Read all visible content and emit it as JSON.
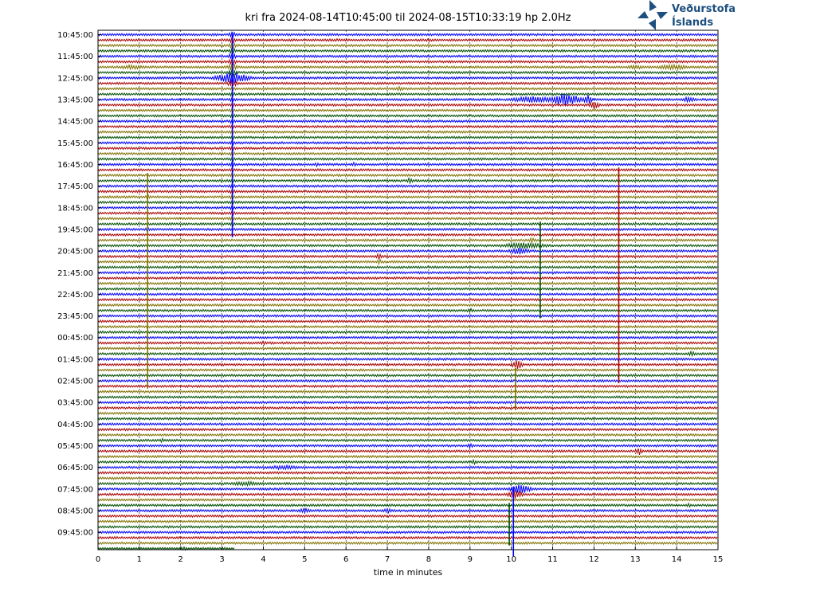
{
  "colors": {
    "trace_cycle": [
      "#0000ff",
      "#aa0000",
      "#807000",
      "#004f00"
    ],
    "logo": "#1d4f7f",
    "grid": "#000000"
  },
  "logo": {
    "icon": "vedurstofa-cross-arrows-icon",
    "line1": "Veðurstofa",
    "line2": "Íslands"
  },
  "chart_data": {
    "type": "line",
    "title": "kri fra 2024-08-14T10:45:00 til 2024-08-15T10:33:19 hp 2.0Hz",
    "xlabel": "time in minutes",
    "ylabel": "",
    "xlim": [
      0,
      15
    ],
    "x_ticks": [
      "0",
      "1",
      "2",
      "3",
      "4",
      "5",
      "6",
      "7",
      "8",
      "9",
      "10",
      "11",
      "12",
      "13",
      "14",
      "15"
    ],
    "y_tick_labels": [
      "10:45:00",
      "11:45:00",
      "12:45:00",
      "13:45:00",
      "14:45:00",
      "15:45:00",
      "16:45:00",
      "17:45:00",
      "18:45:00",
      "19:45:00",
      "20:45:00",
      "21:45:00",
      "22:45:00",
      "23:45:00",
      "00:45:00",
      "01:45:00",
      "02:45:00",
      "03:45:00",
      "04:45:00",
      "05:45:00",
      "06:45:00",
      "07:45:00",
      "08:45:00",
      "09:45:00"
    ],
    "rows_per_label": 4,
    "row_count": 96,
    "last_row_end_minute": 3.3,
    "grid": "vertical dashed at each minute",
    "events": [
      {
        "row": 0,
        "x": 3.25,
        "amp": 5,
        "dur": 0.25
      },
      {
        "row": 1,
        "x": 3.25,
        "amp": 5,
        "dur": 0.25
      },
      {
        "row": 2,
        "x": 3.25,
        "amp": 5,
        "dur": 0.25
      },
      {
        "row": 3,
        "x": 3.25,
        "amp": 5,
        "dur": 0.25
      },
      {
        "row": 4,
        "x": 3.25,
        "amp": 5,
        "dur": 0.3
      },
      {
        "row": 5,
        "x": 3.25,
        "amp": 5,
        "dur": 0.3
      },
      {
        "row": 6,
        "x": 3.25,
        "amp": 6,
        "dur": 0.35
      },
      {
        "row": 7,
        "x": 3.25,
        "amp": 5,
        "dur": 0.3
      },
      {
        "row": 8,
        "x": 3.25,
        "amp": 8,
        "dur": 1.2
      },
      {
        "row": 9,
        "x": 3.25,
        "amp": 5,
        "dur": 0.4
      },
      {
        "row": 10,
        "x": 3.25,
        "amp": 3,
        "dur": 0.3
      },
      {
        "row": 11,
        "x": 3.25,
        "amp": 3,
        "dur": 0.3
      },
      {
        "row": 12,
        "x": 3.25,
        "amp": 3,
        "dur": 0.3
      },
      {
        "row": 13,
        "x": 3.25,
        "amp": 3,
        "dur": 0.3
      },
      {
        "row": 14,
        "x": 3.25,
        "amp": 3,
        "dur": 0.3
      },
      {
        "row": 15,
        "x": 3.25,
        "amp": 3,
        "dur": 0.3
      },
      {
        "row": 16,
        "x": 3.25,
        "amp": 3,
        "dur": 0.3
      },
      {
        "row": 17,
        "x": 3.25,
        "amp": 3,
        "dur": 0.3
      },
      {
        "row": 18,
        "x": 3.25,
        "amp": 3,
        "dur": 0.3
      },
      {
        "row": 19,
        "x": 3.25,
        "amp": 3,
        "dur": 0.3
      },
      {
        "row": 20,
        "x": 3.25,
        "amp": 3,
        "dur": 0.3
      },
      {
        "row": 21,
        "x": 3.25,
        "amp": 3,
        "dur": 0.3
      },
      {
        "row": 22,
        "x": 3.25,
        "amp": 3,
        "dur": 0.3
      },
      {
        "row": 23,
        "x": 3.25,
        "amp": 3,
        "dur": 0.3
      },
      {
        "row": 24,
        "x": 3.25,
        "amp": 3,
        "dur": 0.3
      },
      {
        "row": 25,
        "x": 3.25,
        "amp": 3,
        "dur": 0.3
      },
      {
        "row": 26,
        "x": 3.25,
        "amp": 3,
        "dur": 0.3
      },
      {
        "row": 27,
        "x": 3.25,
        "amp": 3,
        "dur": 0.3
      },
      {
        "row": 28,
        "x": 3.25,
        "amp": 3,
        "dur": 0.3
      },
      {
        "row": 29,
        "x": 3.25,
        "amp": 3,
        "dur": 0.3
      },
      {
        "row": 30,
        "x": 3.25,
        "amp": 3,
        "dur": 0.3
      },
      {
        "row": 31,
        "x": 3.25,
        "amp": 3,
        "dur": 0.3
      },
      {
        "row": 32,
        "x": 3.25,
        "amp": 3,
        "dur": 0.3
      },
      {
        "row": 33,
        "x": 3.25,
        "amp": 3,
        "dur": 0.3
      },
      {
        "row": 34,
        "x": 3.25,
        "amp": 3,
        "dur": 0.3
      },
      {
        "row": 35,
        "x": 3.25,
        "amp": 3,
        "dur": 0.3
      },
      {
        "row": 1,
        "x": 5.8,
        "amp": 2,
        "dur": 0.5
      },
      {
        "row": 1,
        "x": 8.0,
        "amp": 2,
        "dur": 0.5
      },
      {
        "row": 6,
        "x": 0.8,
        "amp": 3,
        "dur": 1.3
      },
      {
        "row": 6,
        "x": 13.0,
        "amp": 3,
        "dur": 0.8
      },
      {
        "row": 6,
        "x": 13.9,
        "amp": 4,
        "dur": 1.2
      },
      {
        "row": 7,
        "x": 3.3,
        "amp": 3,
        "dur": 0.3
      },
      {
        "row": 10,
        "x": 7.3,
        "amp": 3,
        "dur": 0.4
      },
      {
        "row": 12,
        "x": 10.5,
        "amp": 5,
        "dur": 1.5
      },
      {
        "row": 12,
        "x": 11.3,
        "amp": 8,
        "dur": 1.4
      },
      {
        "row": 12,
        "x": 11.85,
        "amp": 8,
        "dur": 0.3
      },
      {
        "row": 12,
        "x": 14.3,
        "amp": 4,
        "dur": 0.5
      },
      {
        "row": 13,
        "x": 12.0,
        "amp": 6,
        "dur": 0.4
      },
      {
        "row": 14,
        "x": 3.8,
        "amp": 2,
        "dur": 0.3
      },
      {
        "row": 16,
        "x": 11.8,
        "amp": 2,
        "dur": 0.4
      },
      {
        "row": 20,
        "x": 14.5,
        "amp": 2,
        "dur": 0.5
      },
      {
        "row": 24,
        "x": 5.3,
        "amp": 3,
        "dur": 0.2
      },
      {
        "row": 24,
        "x": 6.2,
        "amp": 3,
        "dur": 0.2
      },
      {
        "row": 26,
        "x": 11.0,
        "amp": 2,
        "dur": 1.5
      },
      {
        "row": 27,
        "x": 7.55,
        "amp": 4,
        "dur": 0.3
      },
      {
        "row": 30,
        "x": 1.2,
        "amp": 3,
        "dur": 0.2
      },
      {
        "row": 36,
        "x": 1.2,
        "amp": 3,
        "dur": 0.2
      },
      {
        "row": 38,
        "x": 10.5,
        "amp": 3,
        "dur": 0.4
      },
      {
        "row": 39,
        "x": 10.3,
        "amp": 4,
        "dur": 2.0
      },
      {
        "row": 40,
        "x": 10.2,
        "amp": 5,
        "dur": 0.8
      },
      {
        "row": 41,
        "x": 6.8,
        "amp": 4,
        "dur": 0.3
      },
      {
        "row": 42,
        "x": 6.8,
        "amp": 4,
        "dur": 0.2
      },
      {
        "row": 47,
        "x": 12.6,
        "amp": 3,
        "dur": 0.2
      },
      {
        "row": 51,
        "x": 9.0,
        "amp": 3,
        "dur": 0.3
      },
      {
        "row": 53,
        "x": 11.1,
        "amp": 2,
        "dur": 0.2
      },
      {
        "row": 57,
        "x": 4.0,
        "amp": 3,
        "dur": 0.3
      },
      {
        "row": 59,
        "x": 14.35,
        "amp": 4,
        "dur": 0.3
      },
      {
        "row": 61,
        "x": 10.15,
        "amp": 7,
        "dur": 0.4
      },
      {
        "row": 65,
        "x": 5.65,
        "amp": 2,
        "dur": 0.2
      },
      {
        "row": 69,
        "x": 5.6,
        "amp": 2,
        "dur": 0.3
      },
      {
        "row": 75,
        "x": 1.55,
        "amp": 3,
        "dur": 0.2
      },
      {
        "row": 76,
        "x": 9.0,
        "amp": 4,
        "dur": 0.2
      },
      {
        "row": 76,
        "x": 10.8,
        "amp": 2,
        "dur": 0.2
      },
      {
        "row": 77,
        "x": 13.1,
        "amp": 5,
        "dur": 0.25
      },
      {
        "row": 79,
        "x": 9.1,
        "amp": 3,
        "dur": 0.3
      },
      {
        "row": 80,
        "x": 4.5,
        "amp": 3,
        "dur": 1.6
      },
      {
        "row": 83,
        "x": 3.6,
        "amp": 3,
        "dur": 1.5
      },
      {
        "row": 84,
        "x": 10.2,
        "amp": 7,
        "dur": 0.8
      },
      {
        "row": 85,
        "x": 10.1,
        "amp": 6,
        "dur": 0.6
      },
      {
        "row": 87,
        "x": 14.3,
        "amp": 3,
        "dur": 0.2
      },
      {
        "row": 88,
        "x": 5.0,
        "amp": 3,
        "dur": 0.6
      },
      {
        "row": 88,
        "x": 7.0,
        "amp": 3,
        "dur": 0.5
      },
      {
        "row": 95,
        "x": 2.1,
        "amp": 3,
        "dur": 0.3
      }
    ],
    "spikes": [
      {
        "x": 3.25,
        "row_from": 0,
        "row_to": 37
      },
      {
        "x": 1.2,
        "row_from": 26,
        "row_to": 65
      },
      {
        "x": 12.6,
        "row_from": 25,
        "row_to": 64
      },
      {
        "x": 10.7,
        "row_from": 35,
        "row_to": 52
      },
      {
        "x": 10.1,
        "row_from": 62,
        "row_to": 69
      },
      {
        "x": 10.05,
        "row_from": 84,
        "row_to": 96
      },
      {
        "x": 9.95,
        "row_from": 87,
        "row_to": 94
      }
    ]
  }
}
